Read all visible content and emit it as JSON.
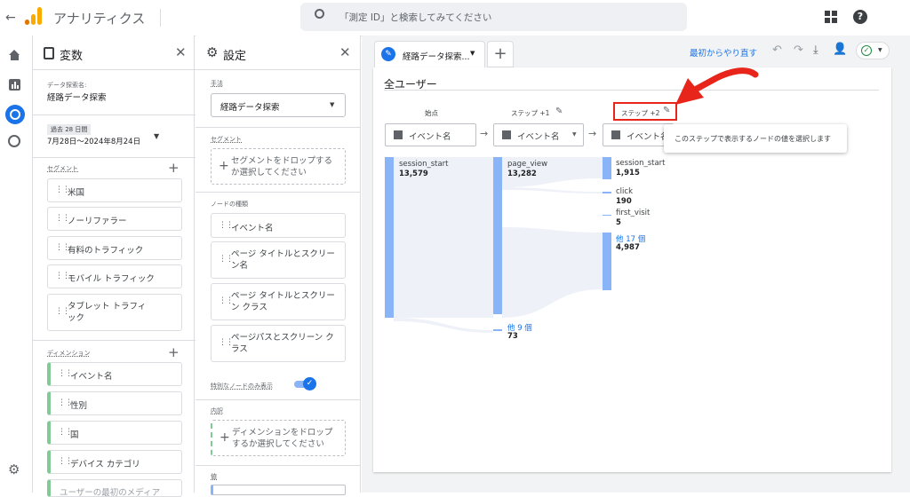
{
  "app": {
    "title": "アナリティクス"
  },
  "search": {
    "placeholder": "「測定 ID」と検索してみてください"
  },
  "variables": {
    "title": "変数",
    "exploration_label": "データ探索名:",
    "exploration_name": "経路データ探索",
    "date_label": "過去 28 日間",
    "date_range": "7月28日～2024年8月24日",
    "segments_label": "セグメント",
    "segments": [
      "米国",
      "ノーリファラー",
      "有料のトラフィック",
      "モバイル トラフィック",
      "タブレット トラフィック"
    ],
    "dimensions_label": "ディメンション",
    "dimensions": [
      "イベント名",
      "性別",
      "国",
      "デバイス カテゴリ",
      "ユーザーの最初のメディア"
    ]
  },
  "settings": {
    "title": "設定",
    "technique_label": "手法",
    "technique_value": "経路データ探索",
    "segment_label": "セグメント",
    "segment_drop": "セグメントをドロップするか選択してください",
    "node_type_label": "ノードの種類",
    "node_types": [
      "イベント名",
      "ページ タイトルとスクリーン名",
      "ページ タイトルとスクリーン クラス",
      "ページパスとスクリーン クラス"
    ],
    "unique_nodes_label": "特別なノードのみ表示",
    "unique_nodes_on": true,
    "breakdown_label": "内訳",
    "breakdown_drop": "ディメンションをドロップするか選択してください",
    "values_label": "値"
  },
  "tab": {
    "label": "経路データ探索..."
  },
  "toolbar": {
    "reset": "最初からやり直す"
  },
  "canvas": {
    "segment_title": "全ユーザー",
    "col0": {
      "label": "始点",
      "dimension": "イベント名"
    },
    "col1": {
      "label": "ステップ +1",
      "dimension": "イベント名"
    },
    "col2": {
      "label": "ステップ +2",
      "dimension": "イベント名"
    },
    "tooltip": "このステップで表示するノードの値を選択します",
    "nodes": {
      "n0": {
        "name": "session_start",
        "value": "13,579"
      },
      "n1": {
        "name": "page_view",
        "value": "13,282"
      },
      "n1b": {
        "name": "他 9 個",
        "value": "73"
      },
      "n2a": {
        "name": "session_start",
        "value": "1,915"
      },
      "n2b": {
        "name": "click",
        "value": "190"
      },
      "n2c": {
        "name": "first_visit",
        "value": "5"
      },
      "n2d": {
        "name": "他 17 個",
        "value": "4,987"
      }
    }
  },
  "colors": {
    "accent": "#1a73e8",
    "annotation": "#e8251b",
    "node": "#8ab4f8",
    "logo": "#f9ab00"
  }
}
